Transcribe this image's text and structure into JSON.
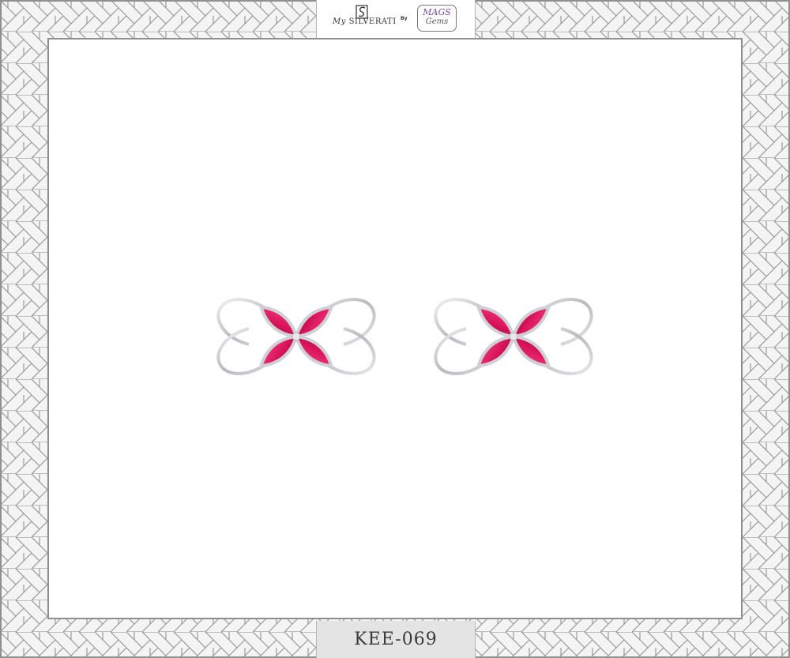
{
  "header": {
    "brand_prefix": "My",
    "brand_name": "SILVERATI",
    "by_label": "By",
    "partner_line1": "MAGS",
    "partner_line2": "Gems"
  },
  "product": {
    "code": "KEE-069",
    "stone_color": "#e2185e",
    "metal_color": "#d9d9dc"
  },
  "colors": {
    "frame_line": "#9a9a9a",
    "frame_bg": "#f4f4f4",
    "inner_bg": "#ffffff"
  }
}
